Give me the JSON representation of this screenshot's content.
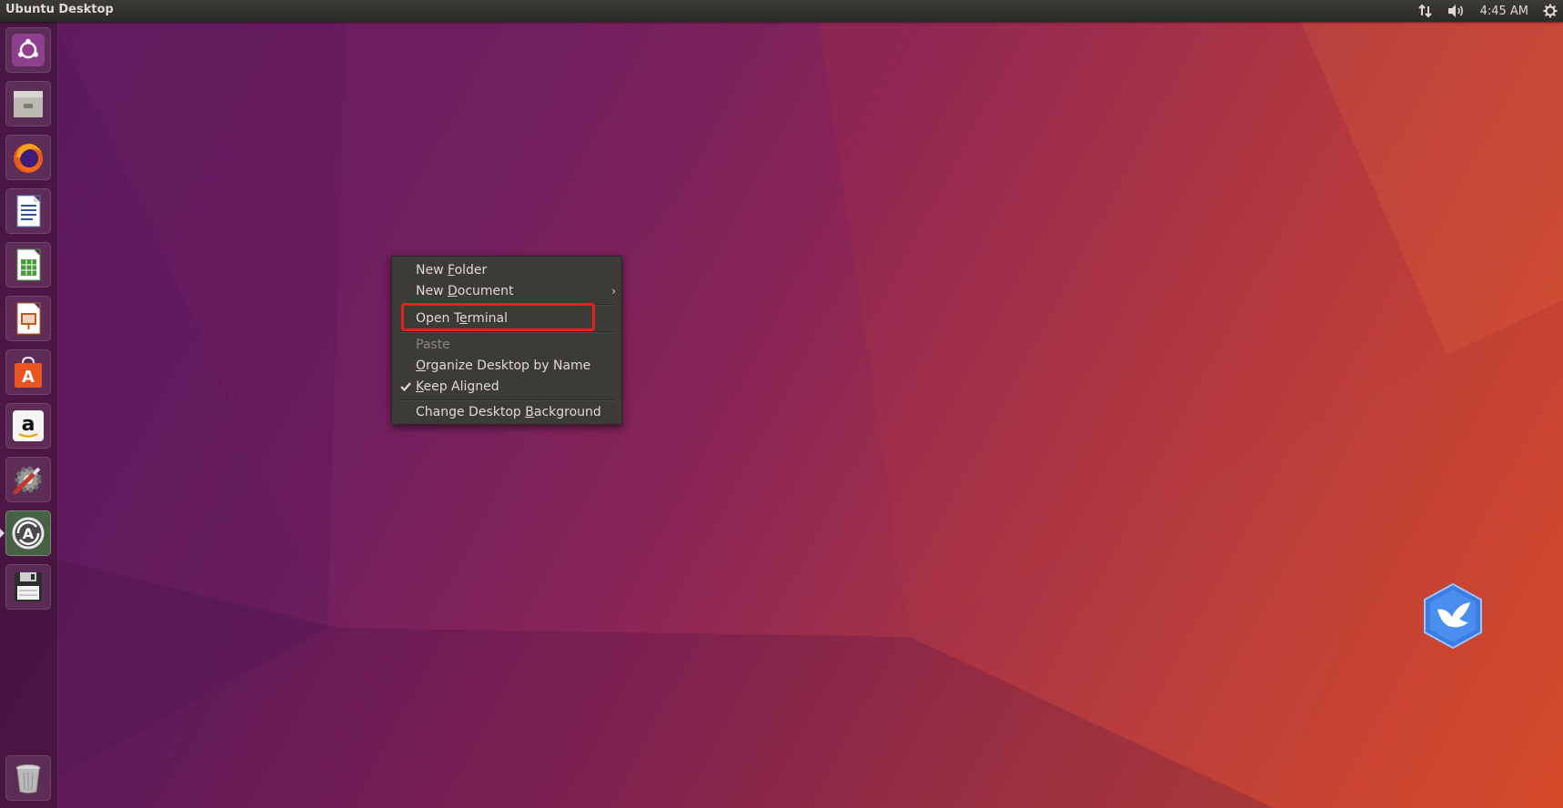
{
  "top_panel": {
    "title": "Ubuntu Desktop",
    "clock": "4:45 AM",
    "indicators": [
      "network-transfer-icon",
      "volume-icon",
      "gear-icon"
    ]
  },
  "launcher": {
    "items": [
      {
        "name": "ubuntu-logo-icon"
      },
      {
        "name": "files-icon"
      },
      {
        "name": "firefox-icon"
      },
      {
        "name": "libreoffice-writer-icon"
      },
      {
        "name": "libreoffice-calc-icon"
      },
      {
        "name": "libreoffice-impress-icon"
      },
      {
        "name": "software-center-icon"
      },
      {
        "name": "amazon-icon"
      },
      {
        "name": "system-settings-icon"
      },
      {
        "name": "software-updater-icon",
        "active": true
      },
      {
        "name": "floppy-save-icon"
      },
      {
        "name": "trash-icon"
      }
    ]
  },
  "context_menu": {
    "new_folder_pre": "New ",
    "new_folder_mn": "F",
    "new_folder_post": "older",
    "new_document_pre": "New ",
    "new_document_mn": "D",
    "new_document_post": "ocument",
    "submenu_arrow": "›",
    "open_terminal_pre": "Open T",
    "open_terminal_mn": "e",
    "open_terminal_post": "rminal",
    "paste": "Paste",
    "organize_mn": "O",
    "organize_post": "rganize Desktop by Name",
    "keep_aligned_mn": "K",
    "keep_aligned_post": "eep Aligned",
    "change_bg_pre": "Change Desktop ",
    "change_bg_mn": "B",
    "change_bg_post": "ackground",
    "keep_aligned_checked": true
  },
  "colors": {
    "highlight_border": "#e8201c",
    "menu_bg": "#3c3b37",
    "panel_bg": "#2c2b28"
  }
}
